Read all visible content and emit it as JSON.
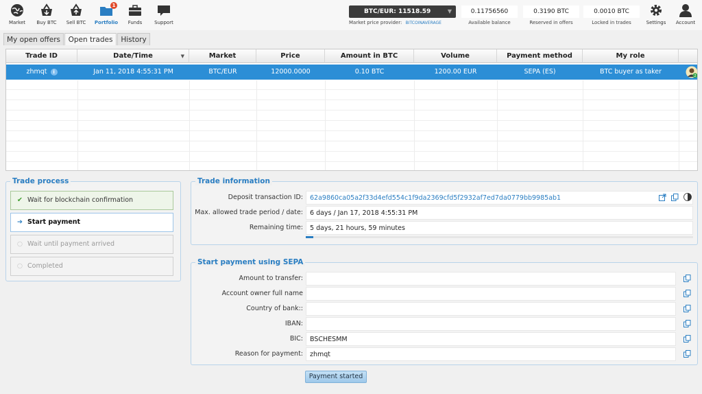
{
  "nav": {
    "items": [
      {
        "label": "Market",
        "icon": "globe-icon"
      },
      {
        "label": "Buy BTC",
        "icon": "buy-icon"
      },
      {
        "label": "Sell BTC",
        "icon": "sell-icon"
      },
      {
        "label": "Portfolio",
        "icon": "folder-icon",
        "badge": "1"
      },
      {
        "label": "Funds",
        "icon": "briefcase-icon"
      },
      {
        "label": "Support",
        "icon": "chat-icon"
      }
    ],
    "settings_label": "Settings",
    "account_label": "Account"
  },
  "market_price": {
    "selector": "BTC/EUR: 11518.59",
    "provider_label": "Market price provider:",
    "provider_name": "BITCOINAVERAGE"
  },
  "balances": [
    {
      "value": "0.11756560",
      "label": "Available balance"
    },
    {
      "value": "0.3190 BTC",
      "label": "Reserved in offers"
    },
    {
      "value": "0.0010 BTC",
      "label": "Locked in trades"
    }
  ],
  "tabs": [
    "My open offers",
    "Open trades",
    "History"
  ],
  "table": {
    "headers": [
      "Trade ID",
      "Date/Time",
      "Market",
      "Price",
      "Amount in BTC",
      "Volume",
      "Payment method",
      "My role"
    ],
    "rows": [
      {
        "trade_id": "zhmqt",
        "date": "Jan 11, 2018 4:55:31 PM",
        "market": "BTC/EUR",
        "price": "12000.0000",
        "amount": "0.10 BTC",
        "volume": "1200.00 EUR",
        "payment": "SEPA (ES)",
        "role": "BTC buyer as taker"
      }
    ]
  },
  "trade_process": {
    "title": "Trade process",
    "steps": [
      {
        "label": "Wait for blockchain confirmation",
        "state": "done"
      },
      {
        "label": "Start payment",
        "state": "current"
      },
      {
        "label": "Wait until payment arrived",
        "state": "pending"
      },
      {
        "label": "Completed",
        "state": "pending"
      }
    ]
  },
  "trade_info": {
    "title": "Trade information",
    "deposit_label": "Deposit transaction ID:",
    "deposit_value": "62a9860ca05a2f33d4efd554c1f9da2369cfd5f2932af7ed7da0779bb9985ab1",
    "period_label": "Max. allowed trade period / date:",
    "period_value": "6 days / Jan 17, 2018 4:55:31 PM",
    "remaining_label": "Remaining time:",
    "remaining_value": "5 days, 21 hours, 59 minutes",
    "remaining_progress": 0.02
  },
  "payment": {
    "title": "Start payment using SEPA",
    "fields": [
      {
        "label": "Amount to transfer:",
        "value": ""
      },
      {
        "label": "Account owner full name",
        "value": ""
      },
      {
        "label": "Country of bank::",
        "value": ""
      },
      {
        "label": "IBAN:",
        "value": ""
      },
      {
        "label": "BIC:",
        "value": "BSCHESMM"
      },
      {
        "label": "Reason for payment:",
        "value": "zhmqt"
      }
    ],
    "button_label": "Payment started"
  },
  "colors": {
    "accent": "#2a7ec2",
    "selected_row": "#2c8ed6",
    "badge": "#e14b2c"
  }
}
